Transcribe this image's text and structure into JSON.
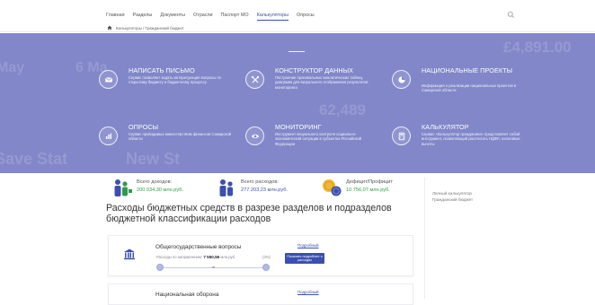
{
  "nav": {
    "items": [
      "Главная",
      "Разделы",
      "Документы",
      "Отрасли",
      "Паспорт МО",
      "Калькуляторы",
      "Опросы"
    ],
    "active_index": 5
  },
  "breadcrumb": {
    "text": "Калькуляторы / Гражданский бюджет"
  },
  "hero": {
    "background_color": "#8187c9",
    "bg_texts": [
      "May",
      "6 Ma",
      "£4,891.00",
      "62,489",
      "Save Stat",
      "New St"
    ],
    "tiles": [
      {
        "title": "НАПИСАТЬ ПИСЬМО",
        "desc": "Сервис позволяет задать интересующие вопросы по открытому бюджету и бюджетному процессу",
        "icon": "mail-icon"
      },
      {
        "title": "КОНСТРУКТОР ДАННЫХ",
        "desc": "Построение произвольных аналитических таблиц, диаграмм для визуального отображения результатов мониторинга",
        "icon": "tools-icon"
      },
      {
        "title": "НАЦИОНАЛЬНЫЕ ПРОЕКТЫ",
        "desc": "Информация о реализации национальных проектов в Самарской области",
        "icon": "pie-icon"
      },
      {
        "title": "ОПРОСЫ",
        "desc": "Сервис проводимых министерством финансов Самарской области",
        "icon": "bar-chart-icon"
      },
      {
        "title": "МОНИТОРИНГ",
        "desc": "Инструмент визуального контроля социально-экономической ситуации в субъектах Российской Федерации",
        "icon": "eye-icon"
      },
      {
        "title": "КАЛЬКУЛЯТОР",
        "desc": "Сервис «Калькулятор гражданина» представляет собой инструмент, позволяющий рассчитать НДФЛ, налоговые вычеты",
        "icon": "calculator-icon"
      }
    ]
  },
  "stats": [
    {
      "label": "Всего доходов:",
      "value": "200 034,30 млн.руб.",
      "color": "green",
      "icon": "people-income-icon"
    },
    {
      "label": "Всего расходов:",
      "value": "277 203,23 млн.руб.",
      "color": "blue",
      "icon": "people-expense-icon"
    },
    {
      "label": "Дефицит/Профицит",
      "value": "10 756,07 млн.руб.",
      "color": "green",
      "icon": "coins-icon"
    }
  ],
  "sidebar": {
    "links": [
      "Личный калькулятор",
      "Гражданский бюджет"
    ]
  },
  "section": {
    "heading": "Расходы бюджетных средств в разрезе разделов и подразделов бюджетной классификации расходов"
  },
  "cards": [
    {
      "title": "Общегосударственные вопросы",
      "sub_label": "Расходы по направлению:",
      "amount": "7 550,56",
      "unit": "млн.руб.",
      "percent": "(3%)",
      "link": "Подробный",
      "button": "Показать подробнее о расходах",
      "icon": "building-icon"
    },
    {
      "title": "Национальная оборона",
      "link": "Подробный"
    }
  ],
  "colors": {
    "accent": "#3b4fb0",
    "hero": "#8187c9",
    "positive": "#2e9a4a"
  }
}
